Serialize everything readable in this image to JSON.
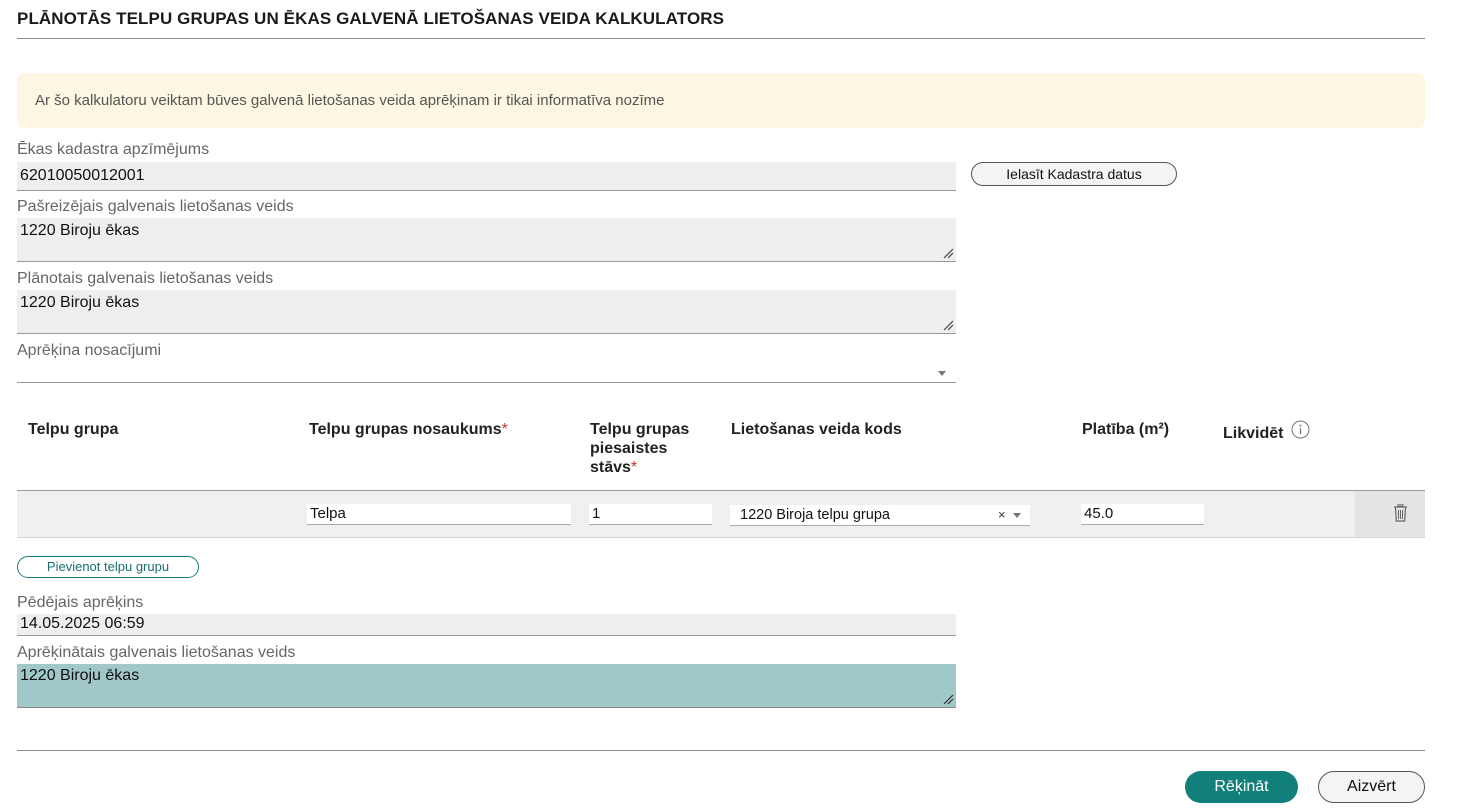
{
  "page": {
    "title": "PLĀNOTĀS TELPU GRUPAS UN ĒKAS GALVENĀ LIETOŠANAS VEIDA KALKULATORS",
    "notice": "Ar šo kalkulatoru veiktam būves galvenā lietošanas veida aprēķinam ir tikai informatīva nozīme"
  },
  "form": {
    "cadastre_label": "Ēkas kadastra apzīmējums",
    "cadastre_value": "62010050012001",
    "read_cadastre_button": "Ielasīt Kadastra datus",
    "current_use_label": "Pašreizējais galvenais lietošanas veids",
    "current_use_value": "1220 Biroju ēkas",
    "planned_use_label": "Plānotais galvenais lietošanas veids",
    "planned_use_value": "1220 Biroju ēkas",
    "conditions_label": "Aprēķina nosacījumi",
    "conditions_value": ""
  },
  "table": {
    "headers": {
      "group": "Telpu grupa",
      "name": "Telpu grupas nosaukums",
      "floor_line1": "Telpu grupas",
      "floor_line2": "piesaistes",
      "floor_line3": "stāvs",
      "code": "Lietošanas veida kods",
      "area": "Platība (m²)",
      "liquidate": "Likvidēt"
    },
    "required_mark": "*",
    "rows": [
      {
        "group": "",
        "name": "Telpa",
        "floor": "1",
        "code": "1220 Biroja telpu grupa",
        "area": "45.0"
      }
    ],
    "clear_symbol": "×",
    "add_button": "Pievienot telpu grupu"
  },
  "result": {
    "last_calc_label": "Pēdējais aprēķins",
    "last_calc_value": "14.05.2025 06:59",
    "calc_use_label": "Aprēķinātais galvenais lietošanas veids",
    "calc_use_value": "1220 Biroju ēkas"
  },
  "footer": {
    "calculate_button": "Rēķināt",
    "close_button": "Aizvērt"
  },
  "colors": {
    "primary": "#12807a",
    "notice_bg": "#fdf6e3",
    "result_bg": "#a0c8c8",
    "required": "#c0392b"
  },
  "icons": [
    "info-icon",
    "trash-icon",
    "chevron-down-icon",
    "resize-handle-icon"
  ]
}
